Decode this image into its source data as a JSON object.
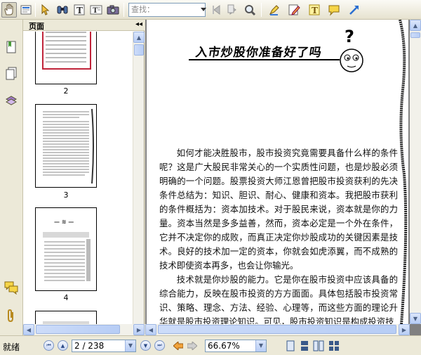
{
  "toolbar": {
    "search_placeholder": "查找：",
    "tools": [
      {
        "name": "hand-tool-icon",
        "active": true
      },
      {
        "name": "select-text-icon"
      },
      {
        "name": "select-icon"
      },
      {
        "name": "binoculars-icon"
      },
      {
        "name": "text-tool-icon"
      },
      {
        "name": "snapshot-icon"
      }
    ]
  },
  "panel": {
    "title": "页面",
    "collapse_glyph": "◂◂",
    "thumbnails": [
      {
        "label": "2"
      },
      {
        "label": "3"
      },
      {
        "label": "4"
      },
      {
        "label": ""
      }
    ]
  },
  "document": {
    "title": "入市炒股你准备好了吗",
    "paragraphs": [
      "如何才能决胜股市，股市投资究竟需要具备什么样的条件呢？这是广大股民非常关心的一个实质性问题，也是炒股必须明确的一个问题。股票投资大师江恩曾把股市投资获利的先决条件总结为：知识、胆识、耐心、健康和资本。我把股市获利的条件概括为：资本加技术。对于股民来说，资本就是你的力量。资本当然是多多益善，然而，资本必定是一个外在条件，它并不决定你的成败，而真正决定你炒股成功的关键因素是技术。良好的技术加一定的资本，你就会如虎添翼，而不成熟的技术即使资本再多，也会让你输光。",
      "技术就是你炒股的能力。它是你在股市投资中应该具备的综合能力，反映在股市投资的方方面面。具体包括股市投资常识、策略、理念、方法、经验、心理等，而这些方面的理论升华就是股市投资理论知识。可见，股市投资知识是构成投资技"
    ]
  },
  "status": {
    "text": "就绪",
    "page_value": "2 / 238",
    "zoom_value": "66.67%"
  },
  "colors": {
    "accent_blue": "#2b6fd1",
    "toolbar_bg": "#ece9d8",
    "doc_bg": "#808080"
  }
}
